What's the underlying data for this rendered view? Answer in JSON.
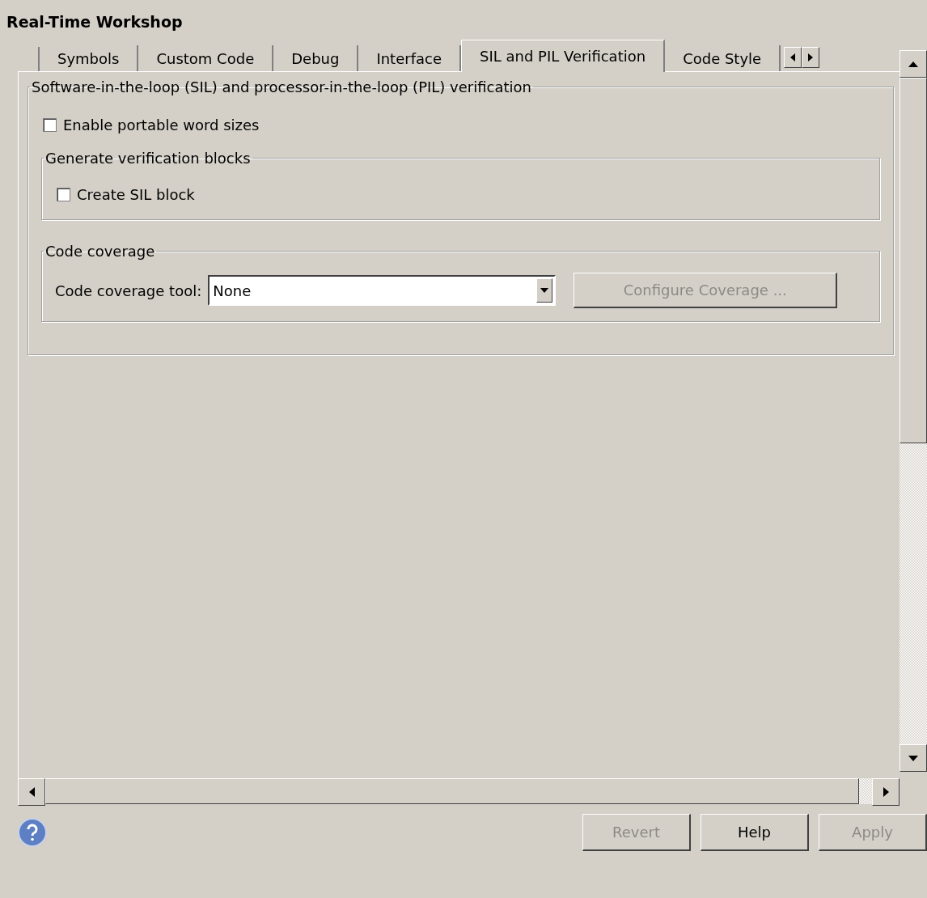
{
  "title": "Real-Time Workshop",
  "tabs": [
    {
      "label": "Symbols",
      "selected": false
    },
    {
      "label": "Custom Code",
      "selected": false
    },
    {
      "label": "Debug",
      "selected": false
    },
    {
      "label": "Interface",
      "selected": false
    },
    {
      "label": "SIL and PIL Verification",
      "selected": true
    },
    {
      "label": "Code Style",
      "selected": false
    }
  ],
  "group": {
    "legend": "Software-in-the-loop (SIL) and processor-in-the-loop (PIL) verification",
    "checkbox": {
      "label": "Enable portable word sizes",
      "checked": false
    },
    "subgroups": [
      {
        "legend": "Generate verification blocks",
        "kind": "checkbox",
        "label": "Create SIL block",
        "checked": false
      },
      {
        "legend": "Code coverage",
        "kind": "dropdown",
        "label": "Code coverage tool:",
        "value": "None",
        "button": {
          "label": "Configure Coverage ...",
          "disabled": true
        }
      }
    ]
  },
  "buttons": [
    {
      "label": "Revert",
      "disabled": true
    },
    {
      "label": "Help",
      "disabled": false
    },
    {
      "label": "Apply",
      "disabled": true
    }
  ]
}
